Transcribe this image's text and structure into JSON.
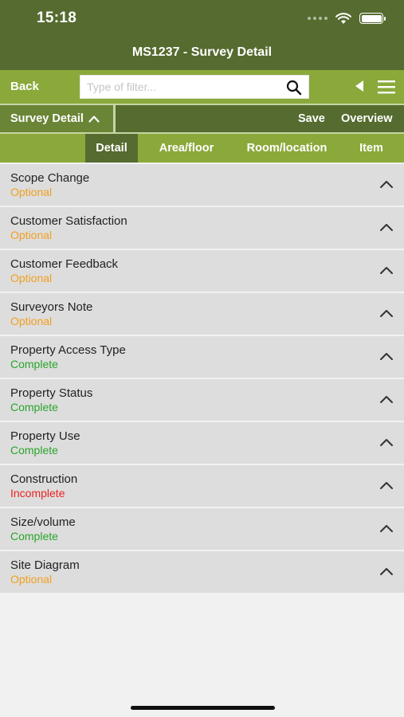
{
  "status_bar": {
    "time": "15:18"
  },
  "header": {
    "title": "MS1237 - Survey Detail"
  },
  "toolbar": {
    "back_label": "Back",
    "search_placeholder": "Type of filter..."
  },
  "section_bar": {
    "dropdown_label": "Survey Detail",
    "save_label": "Save",
    "overview_label": "Overview"
  },
  "tabs": [
    {
      "label": "Detail",
      "active": true
    },
    {
      "label": "Area/floor",
      "active": false
    },
    {
      "label": "Room/location",
      "active": false
    },
    {
      "label": "Item",
      "active": false
    }
  ],
  "items": [
    {
      "label": "Scope Change",
      "status": "Optional"
    },
    {
      "label": "Customer Satisfaction",
      "status": "Optional"
    },
    {
      "label": "Customer Feedback",
      "status": "Optional"
    },
    {
      "label": "Surveyors Note",
      "status": "Optional"
    },
    {
      "label": "Property Access Type",
      "status": "Complete"
    },
    {
      "label": "Property Status",
      "status": "Complete"
    },
    {
      "label": "Property Use",
      "status": "Complete"
    },
    {
      "label": "Construction",
      "status": "Incomplete"
    },
    {
      "label": "Size/volume",
      "status": "Complete"
    },
    {
      "label": "Site Diagram",
      "status": "Optional"
    }
  ],
  "colors": {
    "header_dark": "#556b2f",
    "toolbar_green": "#8aa93a",
    "status_optional": "#f0a020",
    "status_complete": "#2aa52a",
    "status_incomplete": "#ee2222"
  },
  "icons": [
    "wifi-icon",
    "battery-icon",
    "search-icon",
    "triangle-left-icon",
    "menu-icon",
    "chevron-up-icon"
  ]
}
